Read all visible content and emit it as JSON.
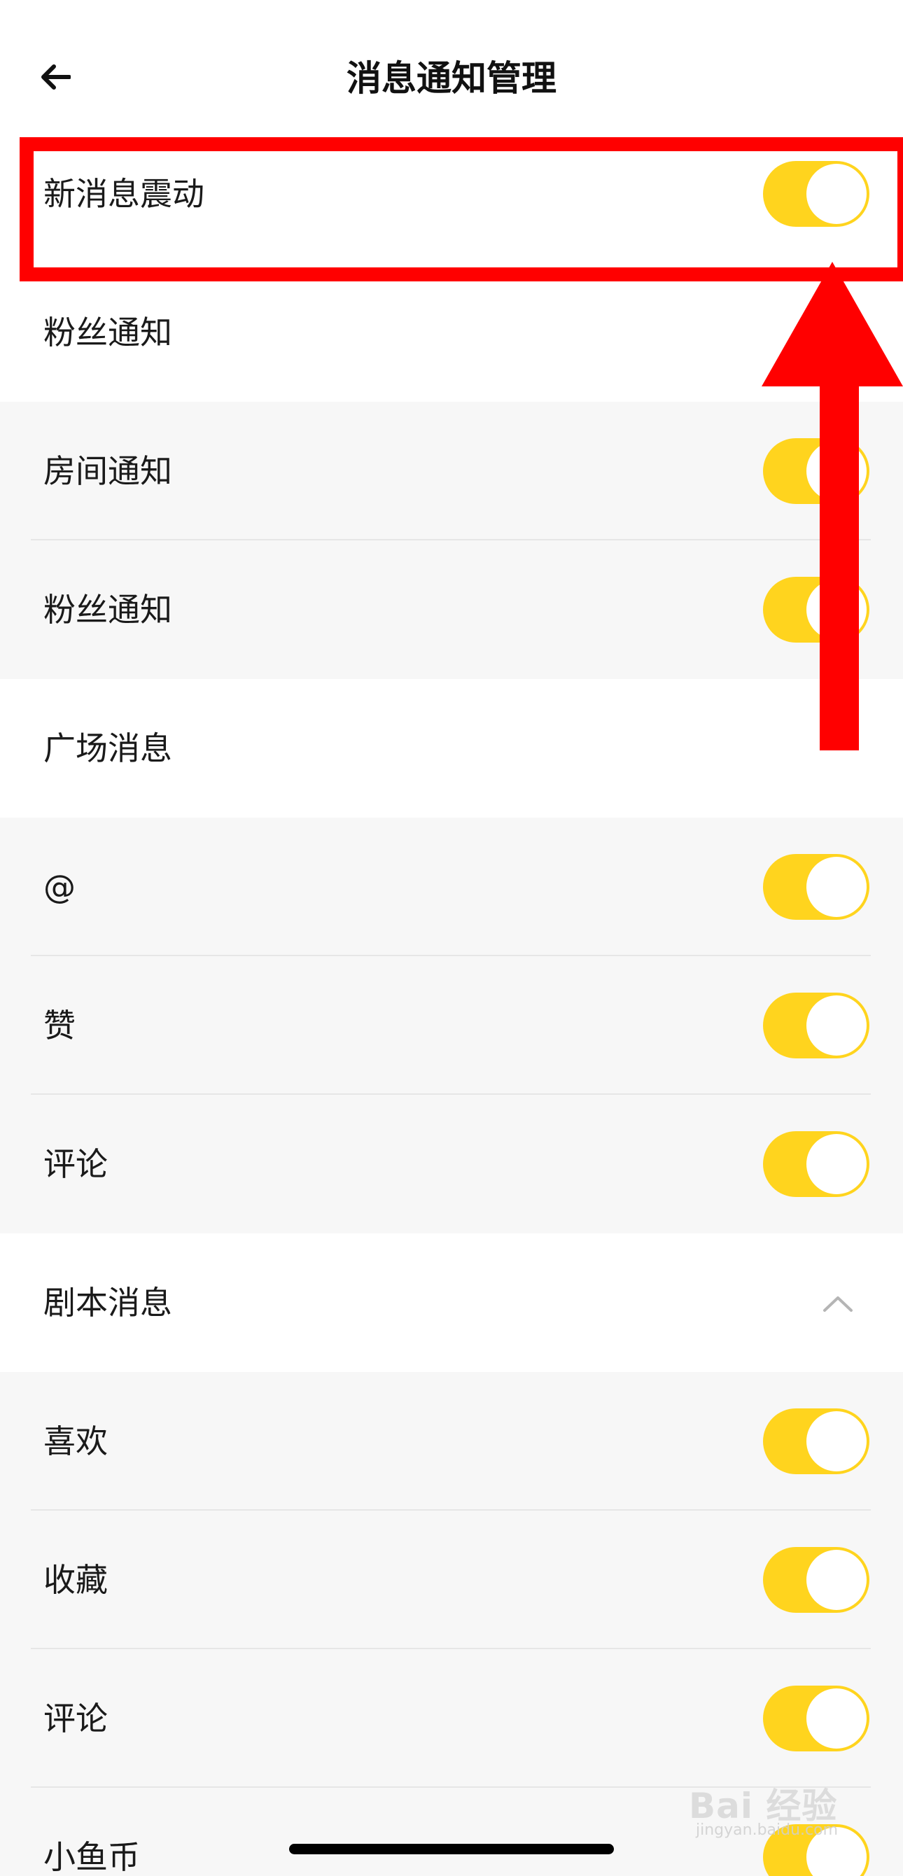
{
  "header": {
    "title": "消息通知管理",
    "back_icon": "arrow-left-icon"
  },
  "rows": [
    {
      "label": "新消息震动",
      "control": "toggle",
      "on": true
    },
    {
      "label": "粉丝通知",
      "control": "none"
    },
    {
      "label": "房间通知",
      "control": "toggle",
      "on": true
    },
    {
      "label": "粉丝通知",
      "control": "toggle",
      "on": true
    },
    {
      "label": "广场消息",
      "control": "none"
    },
    {
      "label": "@",
      "control": "toggle",
      "on": true
    },
    {
      "label": "赞",
      "control": "toggle",
      "on": true
    },
    {
      "label": "评论",
      "control": "toggle",
      "on": true
    },
    {
      "label": "剧本消息",
      "control": "chevron",
      "icon": "chevron-up-icon"
    },
    {
      "label": "喜欢",
      "control": "toggle",
      "on": true
    },
    {
      "label": "收藏",
      "control": "toggle",
      "on": true
    },
    {
      "label": "评论",
      "control": "toggle",
      "on": true
    },
    {
      "label": "小鱼币",
      "control": "toggle",
      "on": true
    }
  ],
  "colors": {
    "toggle_on": "#FFD41E",
    "annotation": "#FF0000",
    "section_bg": "#F7F7F7"
  },
  "watermark": {
    "main": "Bai 经验",
    "sub": "jingyan.baidu.com"
  }
}
